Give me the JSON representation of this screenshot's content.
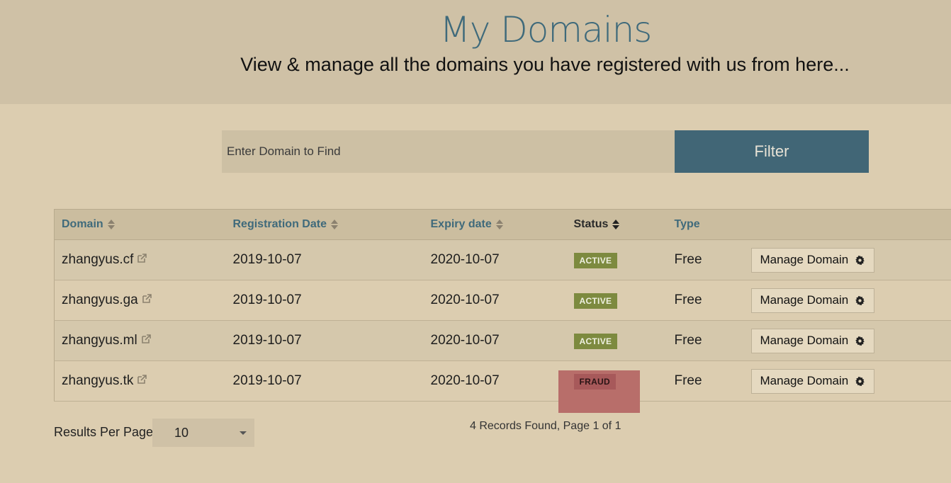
{
  "header": {
    "title": "My Domains",
    "subtitle": "View & manage all the domains you have registered with us from here..."
  },
  "search": {
    "placeholder": "Enter Domain to Find",
    "value": "",
    "button_label": "Filter"
  },
  "table": {
    "columns": [
      "Domain",
      "Registration Date",
      "Expiry date",
      "Status",
      "Type"
    ],
    "rows": [
      {
        "domain": "zhangyus.cf",
        "registration_date": "2019-10-07",
        "expiry_date": "2020-10-07",
        "status": "ACTIVE",
        "type": "Free",
        "action": "Manage Domain"
      },
      {
        "domain": "zhangyus.ga",
        "registration_date": "2019-10-07",
        "expiry_date": "2020-10-07",
        "status": "ACTIVE",
        "type": "Free",
        "action": "Manage Domain"
      },
      {
        "domain": "zhangyus.ml",
        "registration_date": "2019-10-07",
        "expiry_date": "2020-10-07",
        "status": "ACTIVE",
        "type": "Free",
        "action": "Manage Domain"
      },
      {
        "domain": "zhangyus.tk",
        "registration_date": "2019-10-07",
        "expiry_date": "2020-10-07",
        "status": "FRAUD",
        "type": "Free",
        "action": "Manage Domain"
      }
    ]
  },
  "pagination": {
    "results_label": "Results Per Page:",
    "per_page": "10",
    "records_info": "4 Records Found, Page 1 of 1"
  },
  "icons": {
    "external_link": "external-link-icon",
    "settings": "gear-icon",
    "sort": "sort-icon",
    "dropdown": "caret-down-icon"
  },
  "colors": {
    "accent": "#416676",
    "title": "#3f6a7b",
    "active": "#7d8a3f",
    "fraud": "#a7595a"
  }
}
